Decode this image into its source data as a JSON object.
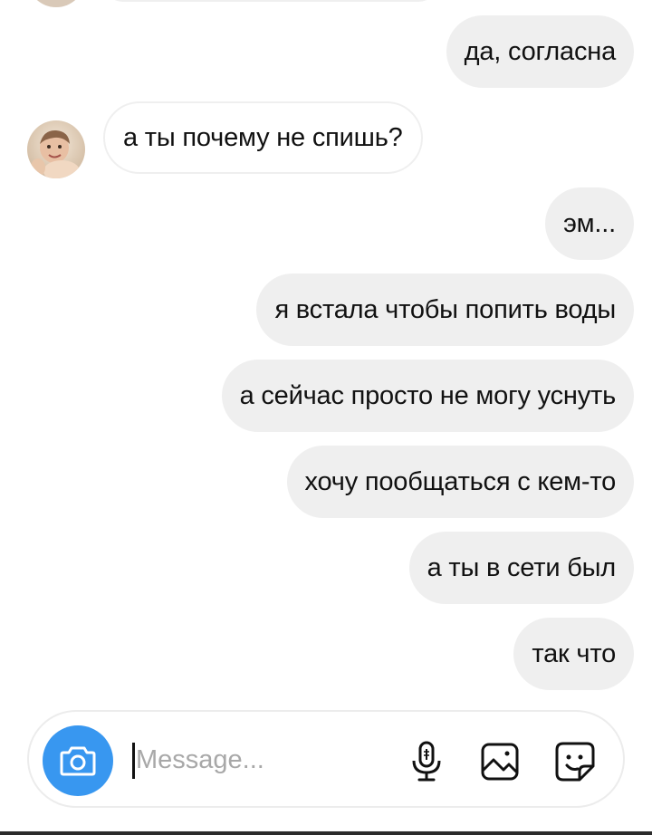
{
  "thread": {
    "messages": [
      {
        "direction": "out",
        "text": "да, согласна"
      },
      {
        "direction": "in",
        "text": "а ты почему не спишь?"
      },
      {
        "direction": "out",
        "text": "эм..."
      },
      {
        "direction": "out",
        "text": "я встала чтобы попить воды"
      },
      {
        "direction": "out",
        "text": "а сейчас просто не могу уснуть"
      },
      {
        "direction": "out",
        "text": "хочу пообщаться с кем-то"
      },
      {
        "direction": "out",
        "text": "а ты в сети был"
      },
      {
        "direction": "out",
        "text": "так что"
      }
    ]
  },
  "composer": {
    "placeholder": "Message...",
    "value": "",
    "camera_icon": "camera-icon",
    "mic_icon": "microphone-icon",
    "gallery_icon": "gallery-icon",
    "sticker_icon": "sticker-icon"
  },
  "colors": {
    "outgoing_bubble": "#efefef",
    "incoming_bubble_border": "#efefef",
    "accent": "#3897f0",
    "text": "#111111",
    "placeholder": "#a8a8a8"
  }
}
